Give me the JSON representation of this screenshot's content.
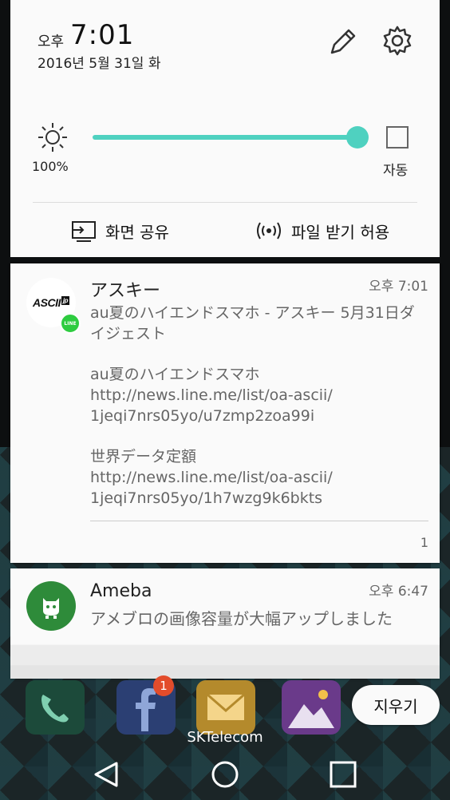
{
  "status": {
    "ampm": "오후",
    "time": "7:01",
    "date": "2016년 5월 31일 화"
  },
  "quick_settings": {
    "brightness_value": "100%",
    "brightness_level": 1.0,
    "auto_label": "자동",
    "screen_share_label": "화면 공유",
    "file_receive_label": "파일 받기 허용"
  },
  "notifications": [
    {
      "app_logo_text": "ASCII",
      "app_logo_suffix": "jp",
      "badge_text": "LINE",
      "title": "アスキー",
      "time": "오후 7:01",
      "subtitle": "au夏のハイエンドスマホ - アスキー 5月31日ダイジェスト",
      "paragraph1": "au夏のハイエンドスマホ\nhttp://news.line.me/list/oa-ascii/\n1jeqi7nrs05yo/u7zmp2zoa99i",
      "paragraph2": "世界データ定額\nhttp://news.line.me/list/oa-ascii/\n1jeqi7nrs05yo/1h7wzg9k6bkts",
      "count": "1"
    },
    {
      "title": "Ameba",
      "time": "오후 6:47",
      "body": "アメブロの画像容量が大幅アップしました"
    }
  ],
  "home": {
    "facebook_badge": "1",
    "clear_all_label": "지우기",
    "carrier": "SKTelecom"
  },
  "colors": {
    "accent": "#4fd1c0",
    "line_green": "#2ecc40",
    "ameba_green": "#2e8b3a"
  },
  "icons": {
    "edit": "pencil-icon",
    "settings": "gear-icon",
    "brightness": "sun-icon",
    "screen_share": "screen-share-icon",
    "file_receive": "wireless-icon",
    "back": "back-icon",
    "home": "home-icon",
    "recent": "recent-apps-icon"
  }
}
